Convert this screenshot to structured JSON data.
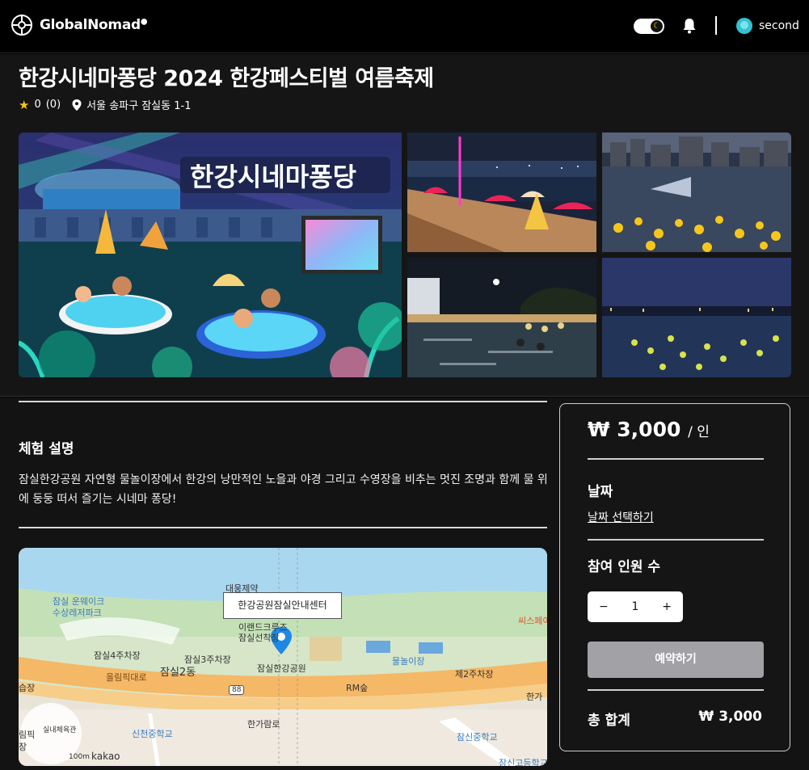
{
  "header": {
    "brand": "GlobalNomad",
    "username": "second"
  },
  "activity": {
    "title": "한강시네마퐁당 2024 한강페스티벌 여름축제",
    "rating": "0",
    "review_count": "(0)",
    "address": "서울 송파구 잠실동 1-1",
    "banner_text": "한강시네마퐁당"
  },
  "description": {
    "heading": "체험 설명",
    "text": "잠실한강공원 자연형 물놀이장에서 한강의 낭만적인 노을과 야경 그리고 수영장을 비추는 멋진 조명과 함께 물 위에 둥둥 떠서 즐기는 시네마 퐁당!"
  },
  "map": {
    "info_label": "한강공원잠실안내센터",
    "labels": {
      "l1": "대웅제약",
      "l2": "잠실 운웨이크",
      "l3": "수상레저파크",
      "l4": "이랜드크루즈",
      "l5": "잠실선착장",
      "l6": "잠실4주차장",
      "l7": "잠실3주차장",
      "l8": "잠실한강공원",
      "l9": "물놀이장",
      "l10": "제2주차장",
      "l11": "올림픽대로",
      "l12": "잠실2동",
      "l13": "RM숲",
      "l14": "88",
      "l15": "한가람로",
      "l16": "신천중학교",
      "l17": "잠신중학교",
      "l18": "잠신고등학교",
      "l19": "실내체육관",
      "l20": "씨스페이",
      "l21": "100m",
      "l22": "kakao",
      "l23": "습장",
      "l24": "림픽",
      "l25": "장",
      "l26": "한가"
    }
  },
  "booking": {
    "price": "₩ 3,000",
    "price_unit": "/ 인",
    "date_label": "날짜",
    "date_link": "날짜 선택하기",
    "people_label": "참여 인원 수",
    "minus": "−",
    "count": "1",
    "plus": "+",
    "reserve_label": "예약하기",
    "total_label": "총 합계",
    "total_value": "₩ 3,000"
  },
  "colors": {
    "background": "#000000",
    "star": "#f8c51b",
    "reserve_button": "#a2a1a6",
    "avatar": "#35c1d1"
  }
}
